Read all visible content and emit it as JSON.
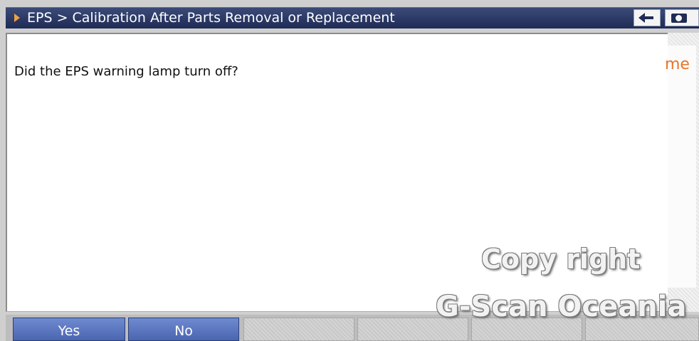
{
  "header": {
    "breadcrumb": "EPS > Calibration After Parts Removal or Replacement",
    "back_icon": "back-arrow-icon",
    "camera_icon": "camera-icon"
  },
  "main": {
    "question": "Did the EPS warning lamp turn off?",
    "clipped_text": "me"
  },
  "footer": {
    "buttons": [
      "Yes",
      "No",
      "",
      "",
      "",
      ""
    ]
  },
  "watermark": {
    "line1": "Copy right",
    "line2": "G-Scan Oceania"
  },
  "colors": {
    "titlebar": "#1f2b55",
    "active_button": "#4a66b0",
    "accent_orange": "#e8742a"
  }
}
